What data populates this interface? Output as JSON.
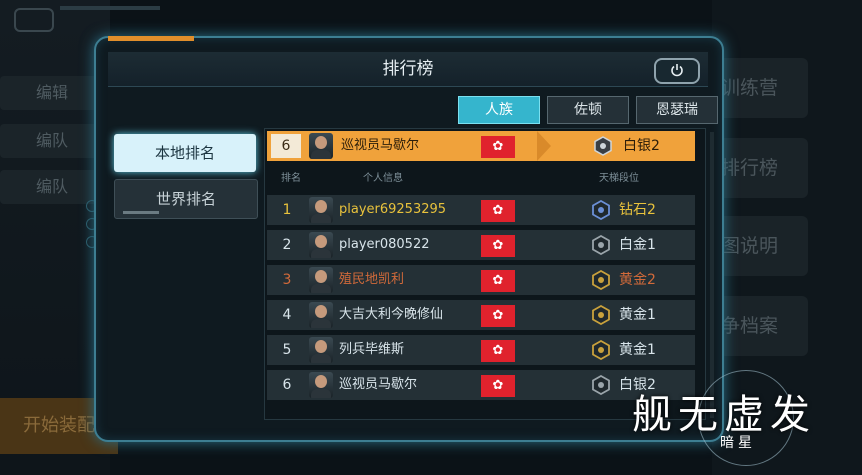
{
  "background": {
    "left_buttons": [
      "编辑",
      "编队",
      "编队"
    ],
    "start_button": "开始装配",
    "right_buttons": [
      "训练营",
      "排行榜",
      "地图说明",
      "战争档案"
    ]
  },
  "dialog": {
    "title": "排行榜",
    "close_icon": "power-icon",
    "tabs": [
      {
        "label": "人族",
        "active": true
      },
      {
        "label": "佐顿",
        "active": false
      },
      {
        "label": "恩瑟瑞",
        "active": false
      }
    ],
    "side": {
      "local": "本地排名",
      "world": "世界排名"
    },
    "my_entry": {
      "rank": "6",
      "name": "巡视员马歇尔",
      "flag": "🇭🇰",
      "tier": "白银2"
    },
    "columns": {
      "rank": "排名",
      "info": "个人信息",
      "tier": "天梯段位"
    },
    "rows": [
      {
        "rank": "1",
        "name": "player69253295",
        "flag": "🇭🇰",
        "tier": "钻石2",
        "color": "#e8c23c",
        "tier_color": "#e8c23c",
        "badge": "#6b8fd6"
      },
      {
        "rank": "2",
        "name": "player080522",
        "flag": "🇭🇰",
        "tier": "白金1",
        "color": "#d8e4ea",
        "tier_color": "#d8e4ea",
        "badge": "#9aa4aa"
      },
      {
        "rank": "3",
        "name": "殖民地凯利",
        "flag": "🇭🇰",
        "tier": "黄金2",
        "color": "#d26a3a",
        "tier_color": "#d26a3a",
        "badge": "#c9a13c"
      },
      {
        "rank": "4",
        "name": "大吉大利今晚修仙",
        "flag": "🇭🇰",
        "tier": "黄金1",
        "color": "#d8e4ea",
        "tier_color": "#d8e4ea",
        "badge": "#c9a13c"
      },
      {
        "rank": "5",
        "name": "列兵毕维斯",
        "flag": "🇭🇰",
        "tier": "黄金1",
        "color": "#d8e4ea",
        "tier_color": "#d8e4ea",
        "badge": "#c9a13c"
      },
      {
        "rank": "6",
        "name": "巡视员马歇尔",
        "flag": "🇭🇰",
        "tier": "白银2",
        "color": "#d8e4ea",
        "tier_color": "#d8e4ea",
        "badge": "#9aa4aa"
      }
    ]
  },
  "watermark": {
    "main": "舰无虚发",
    "sub": "暗星"
  }
}
